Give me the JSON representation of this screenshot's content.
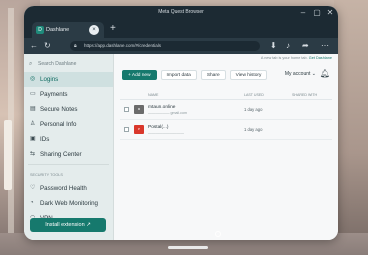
{
  "window": {
    "title": "Meta Quest Browser"
  },
  "tab": {
    "favicon": "D",
    "label": "Dashlane"
  },
  "url": "https://app.dashlane.com/#/credentials",
  "sidebar": {
    "search_placeholder": "Search Dashlane",
    "items": [
      {
        "label": "Logins",
        "icon": "globe-icon",
        "glyph": "◎"
      },
      {
        "label": "Payments",
        "icon": "card-icon",
        "glyph": "▭"
      },
      {
        "label": "Secure Notes",
        "icon": "note-icon",
        "glyph": "▤"
      },
      {
        "label": "Personal Info",
        "icon": "person-icon",
        "glyph": "♙"
      },
      {
        "label": "IDs",
        "icon": "id-icon",
        "glyph": "▣"
      },
      {
        "label": "Sharing Center",
        "icon": "share-icon",
        "glyph": "⇆"
      }
    ],
    "security_section": "SECURITY TOOLS",
    "security_items": [
      {
        "label": "Password Health",
        "icon": "heart-icon",
        "glyph": "♡"
      },
      {
        "label": "Dark Web Monitoring",
        "icon": "radar-icon",
        "glyph": "◔"
      },
      {
        "label": "VPN",
        "icon": "wifi-icon",
        "glyph": "◠"
      }
    ],
    "install_button": "Install extension"
  },
  "main": {
    "banner_text": "A new tab is your home tab.",
    "banner_link": "Get Dashlane",
    "actions": [
      "+ Add new",
      "Import data",
      "Share",
      "View history"
    ],
    "account_label": "My account",
    "columns": [
      "NAME",
      "LAST USED",
      "SHARED WITH"
    ],
    "rows": [
      {
        "name": "mtaun.online",
        "username": "—————— gmail.com",
        "last_used": "1 day ago",
        "logo_color": "#6b6b6b",
        "logo_text": "M"
      },
      {
        "name": "Postal(...)",
        "username": "——————————",
        "last_used": "1 day ago",
        "logo_color": "#d9372b",
        "logo_text": "P"
      }
    ]
  },
  "colors": {
    "accent": "#16796d",
    "titlebar": "#1c2a33"
  }
}
